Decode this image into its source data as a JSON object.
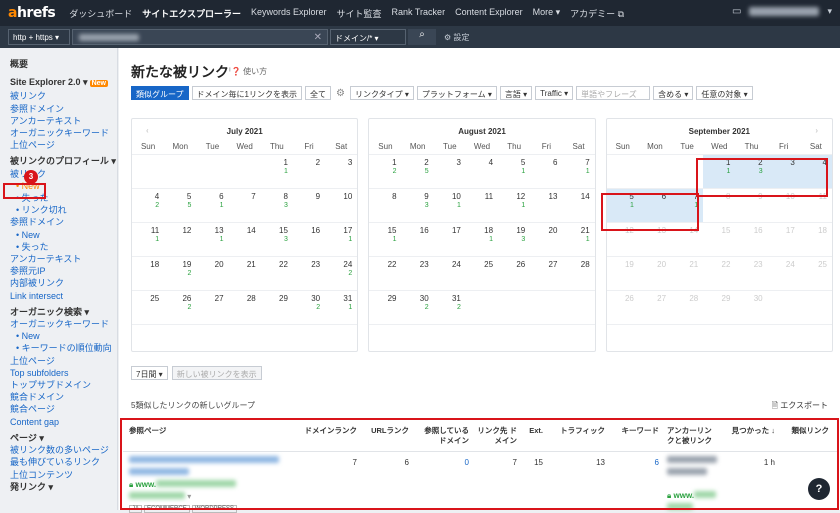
{
  "nav": {
    "logo_a": "a",
    "logo_rest": "hrefs",
    "links": [
      "ダッシュボード",
      "サイトエクスプローラー",
      "Keywords Explorer",
      "サイト監査",
      "Rank Tracker",
      "Content Explorer",
      "More ▾",
      "アカデミー ⧉"
    ]
  },
  "search": {
    "mode": "http + https ▾",
    "scope": "ドメイン/* ▾",
    "settings": "⚙ 設定"
  },
  "sidebar": {
    "overview": "概要",
    "section1_title": "Site Explorer 2.0 ▾",
    "new_badge": "New",
    "s1_items": [
      "被リンク",
      "参照ドメイン",
      "アンカーテキスト",
      "オーガニックキーワード",
      "上位ページ"
    ],
    "profile_title": "被リンクのプロフィール ▾",
    "profile_backlinks": "被リンク",
    "profile_sub": [
      "New",
      "失った",
      "リンク切れ"
    ],
    "ref_domains": "参照ドメイン",
    "ref_sub": [
      "New",
      "失った"
    ],
    "profile_items": [
      "アンカーテキスト",
      "参照元IP",
      "内部被リンク",
      "Link intersect"
    ],
    "organic_title": "オーガニック検索 ▾",
    "organic_kw": "オーガニックキーワード",
    "organic_sub": [
      "New",
      "キーワードの順位動向"
    ],
    "organic_items": [
      "上位ページ",
      "Top subfolders",
      "トップサブドメイン",
      "競合ドメイン",
      "競合ページ",
      "Content gap"
    ],
    "pages_title": "ページ ▾",
    "pages_items": [
      "被リンク数の多いページ",
      "最も伸びているリンク",
      "上位コンテンツ"
    ],
    "outgoing_title": "発リンク ▾"
  },
  "main": {
    "title": "新たな被リンク",
    "title_sup": "i",
    "howto": "❓ 使い方",
    "toolbar": {
      "group": "類似グループ",
      "per_domain": "ドメイン毎に1リンクを表示",
      "all": "全て",
      "link_type": "リンクタイプ ▾",
      "platform": "プラットフォーム ▾",
      "language": "言語 ▾",
      "traffic": "Traffic ▾",
      "phrase_placeholder": "単語やフレーズ",
      "contains": "含める ▾",
      "target": "任意の対象 ▾"
    },
    "period": "7日間 ▾",
    "show_new": "新しい被リンクを表示",
    "groups_caption": "5類似したリンクの新しいグループ",
    "export": "🗎 エクスポート",
    "marker": "3"
  },
  "calendar": {
    "weekdays": [
      "Sun",
      "Mon",
      "Tue",
      "Wed",
      "Thu",
      "Fri",
      "Sat"
    ],
    "months": [
      {
        "title": "July 2021",
        "weeks": [
          [
            {
              "d": ""
            },
            {
              "d": ""
            },
            {
              "d": ""
            },
            {
              "d": ""
            },
            {
              "d": "1",
              "c": "1"
            },
            {
              "d": "2"
            },
            {
              "d": "3"
            }
          ],
          [
            {
              "d": "4",
              "c": "2"
            },
            {
              "d": "5",
              "c": "5"
            },
            {
              "d": "6",
              "c": "1"
            },
            {
              "d": "7"
            },
            {
              "d": "8",
              "c": "3"
            },
            {
              "d": "9"
            },
            {
              "d": "10"
            }
          ],
          [
            {
              "d": "11",
              "c": "1"
            },
            {
              "d": "12"
            },
            {
              "d": "13",
              "c": "1"
            },
            {
              "d": "14"
            },
            {
              "d": "15",
              "c": "3"
            },
            {
              "d": "16"
            },
            {
              "d": "17",
              "c": "1"
            }
          ],
          [
            {
              "d": "18"
            },
            {
              "d": "19",
              "c": "2"
            },
            {
              "d": "20"
            },
            {
              "d": "21"
            },
            {
              "d": "22"
            },
            {
              "d": "23"
            },
            {
              "d": "24",
              "c": "2"
            }
          ],
          [
            {
              "d": "25"
            },
            {
              "d": "26",
              "c": "2"
            },
            {
              "d": "27"
            },
            {
              "d": "28"
            },
            {
              "d": "29"
            },
            {
              "d": "30",
              "c": "2"
            },
            {
              "d": "31",
              "c": "1"
            }
          ],
          [
            {
              "d": ""
            },
            {
              "d": ""
            },
            {
              "d": ""
            },
            {
              "d": ""
            },
            {
              "d": ""
            },
            {
              "d": ""
            },
            {
              "d": ""
            }
          ]
        ]
      },
      {
        "title": "August 2021",
        "weeks": [
          [
            {
              "d": "1",
              "c": "2"
            },
            {
              "d": "2",
              "c": "5"
            },
            {
              "d": "3"
            },
            {
              "d": "4"
            },
            {
              "d": "5",
              "c": "1"
            },
            {
              "d": "6"
            },
            {
              "d": "7",
              "c": "1"
            }
          ],
          [
            {
              "d": "8"
            },
            {
              "d": "9",
              "c": "3"
            },
            {
              "d": "10",
              "c": "1"
            },
            {
              "d": "11"
            },
            {
              "d": "12",
              "c": "1"
            },
            {
              "d": "13"
            },
            {
              "d": "14"
            }
          ],
          [
            {
              "d": "15",
              "c": "1"
            },
            {
              "d": "16"
            },
            {
              "d": "17"
            },
            {
              "d": "18",
              "c": "1"
            },
            {
              "d": "19",
              "c": "3"
            },
            {
              "d": "20"
            },
            {
              "d": "21",
              "c": "1"
            }
          ],
          [
            {
              "d": "22"
            },
            {
              "d": "23"
            },
            {
              "d": "24"
            },
            {
              "d": "25"
            },
            {
              "d": "26"
            },
            {
              "d": "27"
            },
            {
              "d": "28"
            }
          ],
          [
            {
              "d": "29"
            },
            {
              "d": "30",
              "c": "2"
            },
            {
              "d": "31",
              "c": "2"
            },
            {
              "d": ""
            },
            {
              "d": ""
            },
            {
              "d": ""
            },
            {
              "d": ""
            }
          ],
          [
            {
              "d": ""
            },
            {
              "d": ""
            },
            {
              "d": ""
            },
            {
              "d": ""
            },
            {
              "d": ""
            },
            {
              "d": ""
            },
            {
              "d": ""
            }
          ]
        ]
      },
      {
        "title": "September 2021",
        "weeks": [
          [
            {
              "d": ""
            },
            {
              "d": ""
            },
            {
              "d": ""
            },
            {
              "d": "1",
              "c": "1",
              "h": 1
            },
            {
              "d": "2",
              "c": "3",
              "h": 1
            },
            {
              "d": "3",
              "h": 1
            },
            {
              "d": "4",
              "h": 1
            }
          ],
          [
            {
              "d": "5",
              "c": "1",
              "h": 1
            },
            {
              "d": "6",
              "h": 1
            },
            {
              "d": "7",
              "c": "1",
              "h": 1
            },
            {
              "d": "8",
              "o": 1
            },
            {
              "d": "9",
              "o": 1
            },
            {
              "d": "10",
              "o": 1
            },
            {
              "d": "11",
              "o": 1
            }
          ],
          [
            {
              "d": "12",
              "o": 1
            },
            {
              "d": "13",
              "o": 1
            },
            {
              "d": "14",
              "o": 1
            },
            {
              "d": "15",
              "o": 1
            },
            {
              "d": "16",
              "o": 1
            },
            {
              "d": "17",
              "o": 1
            },
            {
              "d": "18",
              "o": 1
            }
          ],
          [
            {
              "d": "19",
              "o": 1
            },
            {
              "d": "20",
              "o": 1
            },
            {
              "d": "21",
              "o": 1
            },
            {
              "d": "22",
              "o": 1
            },
            {
              "d": "23",
              "o": 1
            },
            {
              "d": "24",
              "o": 1
            },
            {
              "d": "25",
              "o": 1
            }
          ],
          [
            {
              "d": "26",
              "o": 1
            },
            {
              "d": "27",
              "o": 1
            },
            {
              "d": "28",
              "o": 1
            },
            {
              "d": "29",
              "o": 1
            },
            {
              "d": "30",
              "o": 1
            },
            {
              "d": ""
            },
            {
              "d": ""
            }
          ],
          [
            {
              "d": ""
            },
            {
              "d": ""
            },
            {
              "d": ""
            },
            {
              "d": ""
            },
            {
              "d": ""
            },
            {
              "d": ""
            },
            {
              "d": ""
            }
          ]
        ]
      }
    ]
  },
  "table": {
    "headers": [
      "参照ページ",
      "ドメインランク",
      "URLランク",
      "参照している ドメイン",
      "リンク先 ドメイン",
      "Ext.",
      "トラフィック",
      "キーワード",
      "アンカーリン クと被リンク",
      "見つかった ↓",
      "類似リンク"
    ],
    "row": {
      "www": "www.",
      "tags": [
        "JA",
        "ECOMMERCE",
        "WORDPRESS"
      ],
      "dr": "7",
      "ur": "6",
      "ref_domains": "0",
      "linked_domains": "7",
      "ext": "15",
      "traffic": "13",
      "keywords": "6",
      "anchor_www": "www.",
      "found": "1 h"
    },
    "help": "?"
  },
  "colors": {
    "accent": "#ff8800",
    "link": "#1766c7",
    "highlight": "#d9e9f7",
    "annotation": "#d9141a"
  }
}
